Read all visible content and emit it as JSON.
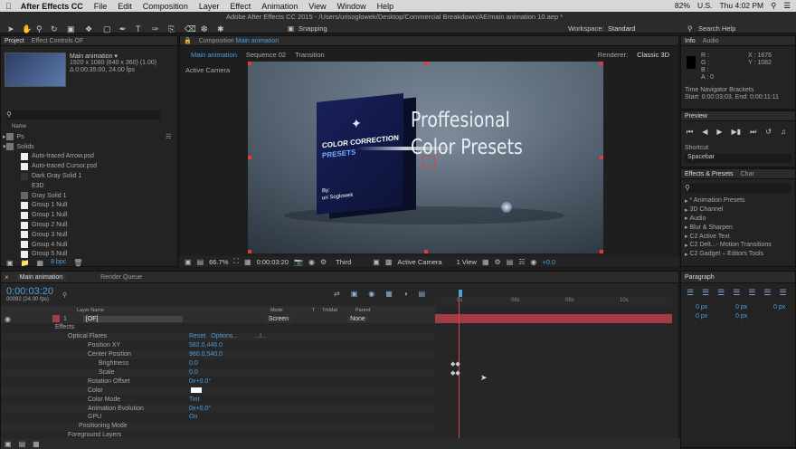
{
  "menubar": {
    "apple": "",
    "app": "After Effects CC",
    "items": [
      "File",
      "Edit",
      "Composition",
      "Layer",
      "Effect",
      "Animation",
      "View",
      "Window",
      "Help"
    ],
    "battery": "82%",
    "lang": "U.S.",
    "time": "Thu 4:02 PM"
  },
  "toolbar": {
    "title": "Adobe After Effects CC 2015 - /Users/urisoglowek/Desktop/Commercial Breakdown/AE/main animation 10.aep *",
    "snapping": "Snapping",
    "workspace_label": "Workspace:",
    "workspace": "Standard",
    "search": "Search Help"
  },
  "project": {
    "tab": "Project",
    "tab2": "Effect Controls OF",
    "comp_name": "Main animation ▾",
    "comp_size": "1920 x 1080  (640 x 360) (1.00)",
    "comp_dur": "Δ 0:00:35:00, 24.00 fps",
    "col_name": "Name",
    "items": [
      "Ps",
      "Solids",
      "Auto-traced Arrow.psd",
      "Auto-traced Cursor.psd",
      "Dark Gray Solid 1",
      "E3D",
      "Gray Solid 1",
      "Group 1 Null",
      "Group 1 Null",
      "Group 2 Null",
      "Group 3 Null",
      "Group 4 Null",
      "Group 5 Null"
    ],
    "bpc": "8 bpc"
  },
  "comp": {
    "tab": "Composition",
    "tab_name": "Main animation",
    "nav": [
      "Main animation",
      "Sequence 02",
      "Transition"
    ],
    "renderer_label": "Renderer:",
    "renderer": "Classic 3D",
    "camera": "Active Camera",
    "box_text1": "COLOR CORRECTION",
    "box_text2": "PRESETS",
    "box_by": "By:",
    "box_author": "uri Soglowek",
    "headline1": "Proffesional",
    "headline2": "Color Presets",
    "zoom": "66.7%",
    "timecode": "0:00:03:20",
    "view": "Third",
    "camera_sel": "Active Camera",
    "views": "1 View",
    "exposure": "+0.0"
  },
  "info": {
    "tab": "Info",
    "tab2": "Audio",
    "r": "R :",
    "g": "G :",
    "b": "B :",
    "a": "A : 0",
    "x": "X : 1676",
    "y": "Y : 1082",
    "nav": "Time Navigator Brackets",
    "nav_range": "Start: 0:00:03:03, End: 0:00:11:11"
  },
  "preview": {
    "tab": "Preview",
    "shortcut_label": "Shortcut",
    "shortcut": "Spacebar"
  },
  "effects": {
    "tab": "Effects & Presets",
    "tab2": "Char",
    "items": [
      "* Animation Presets",
      "3D Channel",
      "Audio",
      "Blur & Sharpen",
      "C2 Active Text",
      "C2 Delt...- Motion Transitions",
      "C2 Gadget – Editors Tools"
    ]
  },
  "paragraph": {
    "tab": "Paragraph",
    "vals": [
      "0 px",
      "0 px",
      "0 px",
      "0 px",
      "0 px"
    ]
  },
  "timeline": {
    "tab": "Main animation",
    "tab2": "Render Queue",
    "timecode": "0:00:03:20",
    "frames": "00092 (24.00 fps)",
    "cols": [
      "Layer Name",
      "Mode",
      "T",
      "TrkMat",
      "Parent"
    ],
    "layer_num": "1",
    "layer_name": "[OF]",
    "mode": "Screen",
    "parent": "None",
    "ruler": [
      "0s",
      "06s",
      "08s",
      "10s"
    ]
  },
  "props": [
    {
      "name": "Effects",
      "val": ""
    },
    {
      "name": "Optical Flares",
      "val": "Reset",
      "extra": "Options...",
      "extra2": "...I..."
    },
    {
      "name": "Position XY",
      "val": "582.0,446.0"
    },
    {
      "name": "Center Position",
      "val": "960.0,540.0"
    },
    {
      "name": "Brightness",
      "val": "0.0"
    },
    {
      "name": "Scale",
      "val": "0.0"
    },
    {
      "name": "Rotation Offset",
      "val": "0x+0.0°"
    },
    {
      "name": "Color",
      "val": ""
    },
    {
      "name": "Color Mode",
      "val": "Tint"
    },
    {
      "name": "Animation Evolution",
      "val": "0x+0.0°"
    },
    {
      "name": "GPU",
      "val": "On"
    },
    {
      "name": "Positioning Mode",
      "val": ""
    },
    {
      "name": "Foreground Layers",
      "val": ""
    }
  ],
  "colors": {
    "accent": "#4d9fde",
    "layer_bar": "#a33b48",
    "handle": "#e53b3b"
  }
}
